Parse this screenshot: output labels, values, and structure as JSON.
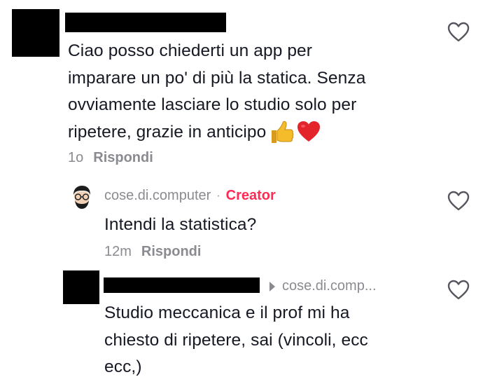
{
  "comments": [
    {
      "text": "Ciao posso chiederti un app per imparare un po' di più la statica. Senza ovviamente lasciare lo studio solo per ripetere, grazie in anticipo",
      "lines": [
        "Ciao posso chiederti un app per",
        "imparare un po' di più la statica. Senza",
        "ovviamente lasciare lo studio solo per",
        "ripetere, grazie in anticipo"
      ],
      "emojis": [
        "thumbs-up",
        "red-heart"
      ],
      "time": "1o",
      "reply_label": "Rispondi"
    },
    {
      "username": "cose.di.computer",
      "separator": "·",
      "badge": "Creator",
      "text": "Intendi la statistica?",
      "time": "12m",
      "reply_label": "Rispondi"
    },
    {
      "reply_to": "cose.di.comp...",
      "lines": [
        "Studio meccanica e il prof mi ha",
        "chiesto di ripetere, sai (vincoli, ecc",
        "ecc,)"
      ]
    }
  ],
  "colors": {
    "text": "#161823",
    "muted": "#8a8b91",
    "creator": "#fe2c55",
    "redaction": "#000000"
  }
}
